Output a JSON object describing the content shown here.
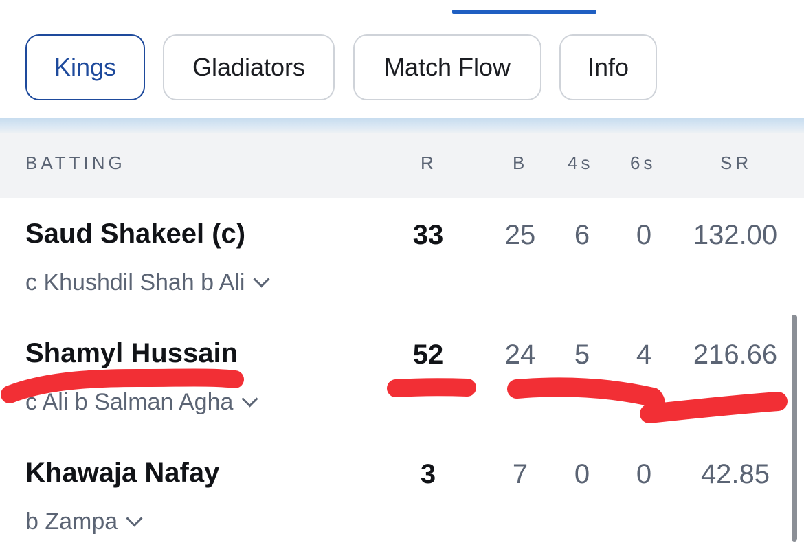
{
  "tabs": [
    {
      "label": "Kings",
      "active": true
    },
    {
      "label": "Gladiators",
      "active": false
    },
    {
      "label": "Match Flow",
      "active": false
    },
    {
      "label": "Info",
      "active": false
    }
  ],
  "table": {
    "headers": {
      "batting": "BATTING",
      "r": "R",
      "b": "B",
      "fours": "4s",
      "sixes": "6s",
      "sr": "SR"
    },
    "rows": [
      {
        "name": "Saud Shakeel (c)",
        "dismissal": "c Khushdil Shah b Ali",
        "r": "33",
        "b": "25",
        "fours": "6",
        "sixes": "0",
        "sr": "132.00"
      },
      {
        "name": "Shamyl Hussain",
        "dismissal": "c Ali b Salman Agha",
        "r": "52",
        "b": "24",
        "fours": "5",
        "sixes": "4",
        "sr": "216.66"
      },
      {
        "name": "Khawaja Nafay",
        "dismissal": "b Zampa",
        "r": "3",
        "b": "7",
        "fours": "0",
        "sixes": "0",
        "sr": "42.85"
      }
    ]
  },
  "colors": {
    "accent": "#1f5fc2",
    "active_chip": "#1e4a9c",
    "annotation": "#f22f35"
  },
  "icons": {
    "expand": "chevron-down-icon"
  }
}
